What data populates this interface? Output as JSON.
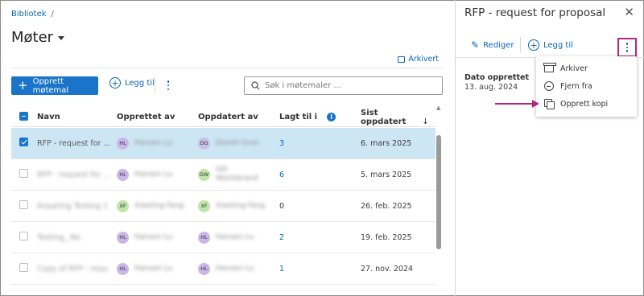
{
  "breadcrumb": {
    "root": "Bibliotek",
    "separator": "/"
  },
  "page": {
    "title": "Møter"
  },
  "archived_link": "Arkivert",
  "toolbar": {
    "create_label": "Opprett møtemal",
    "add_label": "Legg til",
    "search_placeholder": "Søk i møtemaler ..."
  },
  "table": {
    "headers": {
      "name": "Navn",
      "created_by": "Opprettet av",
      "updated_by": "Oppdatert av",
      "added_to": "Lagt til i",
      "last_updated": "Sist oppdatert"
    },
    "rows": [
      {
        "name": "RFP - request for ...",
        "created_by": {
          "initials": "HL",
          "name": "Hansen Lu"
        },
        "updated_by": {
          "initials": "DG",
          "name": "Daniel Gran"
        },
        "added_to": "3",
        "last_updated": "6. mars 2025",
        "selected": true
      },
      {
        "name": "RFP - request for ...",
        "created_by": {
          "initials": "HL",
          "name": "Hansen Lu"
        },
        "updated_by": {
          "initials": "GW",
          "name": "Gill Wormbrand"
        },
        "added_to": "6",
        "last_updated": "5. mars 2025",
        "selected": false
      },
      {
        "name": "Anpating Testing 1",
        "created_by": {
          "initials": "XF",
          "name": "Xiaoting Fang"
        },
        "updated_by": {
          "initials": "XF",
          "name": "Xiaoting Fang"
        },
        "added_to": "0",
        "last_updated": "26. feb. 2025",
        "selected": false
      },
      {
        "name": "Testing_ Ne",
        "created_by": {
          "initials": "HL",
          "name": "Hansen Lu"
        },
        "updated_by": {
          "initials": "HL",
          "name": "Hansen Lu"
        },
        "added_to": "2",
        "last_updated": "19. feb. 2025",
        "selected": false
      },
      {
        "name": "Copy of RFP - requ",
        "created_by": {
          "initials": "HL",
          "name": "Hansen Lu"
        },
        "updated_by": {
          "initials": "HL",
          "name": "Hansen Lu"
        },
        "added_to": "1",
        "last_updated": "27. nov. 2024",
        "selected": false
      }
    ]
  },
  "panel": {
    "title": "RFP - request for proposal",
    "edit_label": "Rediger",
    "add_label": "Legg til",
    "date_created_label": "Dato opprettet",
    "date_created_value": "13. aug. 2024",
    "menu": {
      "archive": "Arkiver",
      "remove_from": "Fjern fra",
      "create_copy": "Opprett kopi"
    }
  },
  "colors": {
    "accent": "#1a75c9",
    "link": "#0b66b7",
    "selected_row": "#cde6f4",
    "highlight": "#b0287d"
  }
}
